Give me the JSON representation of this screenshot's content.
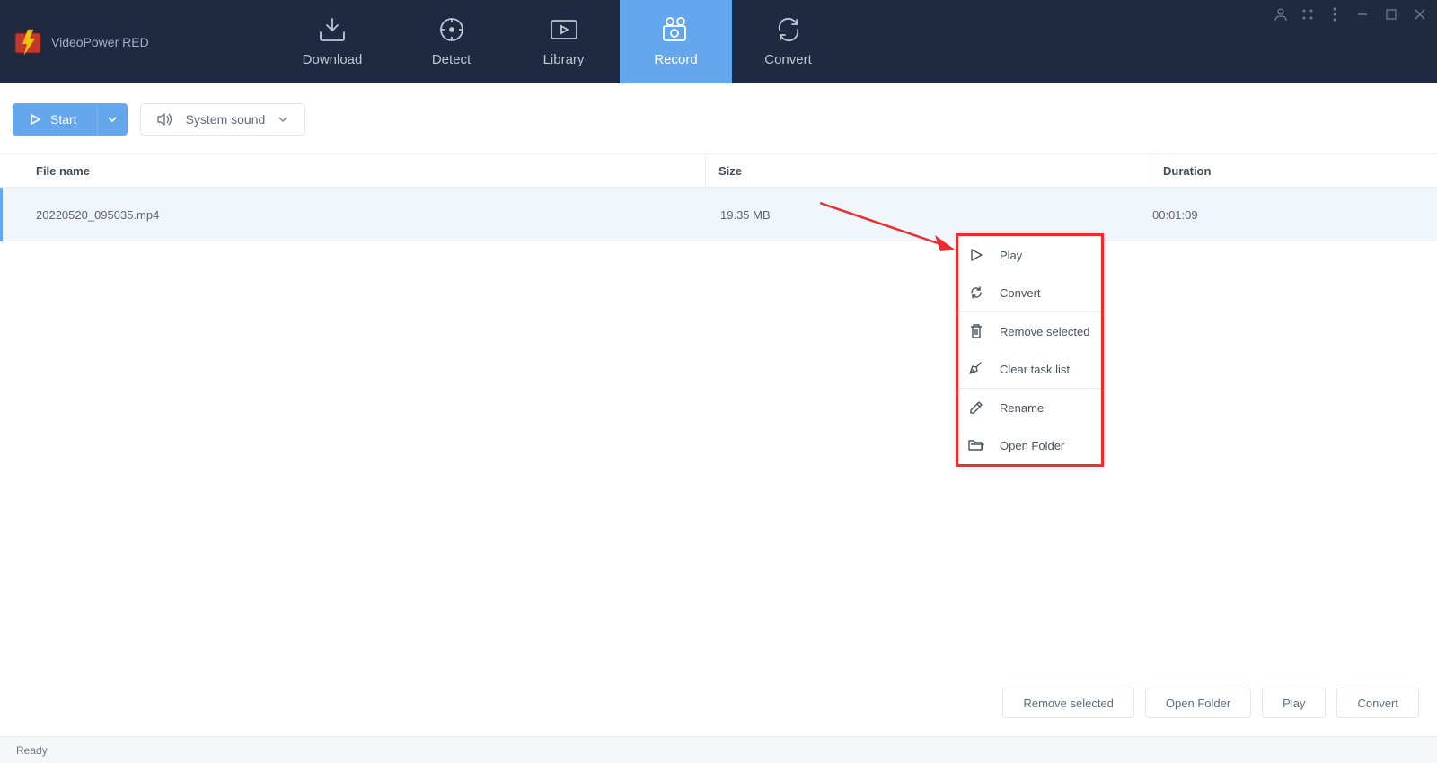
{
  "app": {
    "title": "VideoPower RED"
  },
  "nav": {
    "download": "Download",
    "detect": "Detect",
    "library": "Library",
    "record": "Record",
    "convert": "Convert"
  },
  "toolbar": {
    "start_label": "Start",
    "sound_label": "System sound"
  },
  "table": {
    "headers": {
      "name": "File name",
      "size": "Size",
      "duration": "Duration"
    },
    "rows": [
      {
        "name": "20220520_095035.mp4",
        "size": "19.35 MB",
        "duration": "00:01:09"
      }
    ]
  },
  "context_menu": {
    "play": "Play",
    "convert": "Convert",
    "remove_selected": "Remove selected",
    "clear_task_list": "Clear task list",
    "rename": "Rename",
    "open_folder": "Open Folder"
  },
  "footer": {
    "remove_selected": "Remove selected",
    "open_folder": "Open Folder",
    "play": "Play",
    "convert": "Convert"
  },
  "status": {
    "text": "Ready"
  }
}
